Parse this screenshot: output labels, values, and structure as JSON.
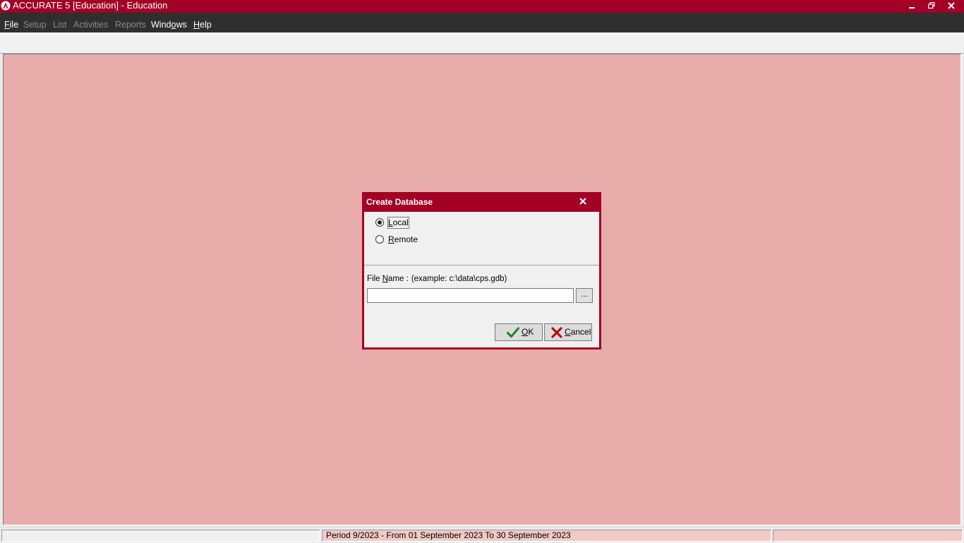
{
  "window": {
    "title": "ACCURATE 5 [Education] - Education",
    "accent_color": "#a20025",
    "workspace_color": "#e8adab"
  },
  "menu": {
    "items": [
      {
        "pre": "",
        "hot": "F",
        "post": "ile",
        "enabled": true
      },
      {
        "pre": "Setup",
        "hot": "",
        "post": "",
        "enabled": false
      },
      {
        "pre": "List",
        "hot": "",
        "post": "",
        "enabled": false
      },
      {
        "pre": "Activities",
        "hot": "",
        "post": "",
        "enabled": false
      },
      {
        "pre": "Reports",
        "hot": "",
        "post": "",
        "enabled": false
      },
      {
        "pre": "Wind",
        "hot": "o",
        "post": "ws",
        "enabled": true
      },
      {
        "pre": "",
        "hot": "H",
        "post": "elp",
        "enabled": true
      }
    ]
  },
  "dialog": {
    "title": "Create Database",
    "options": [
      {
        "hot": "L",
        "rest": "ocal",
        "selected": true
      },
      {
        "hot": "R",
        "rest": "emote",
        "selected": false
      }
    ],
    "file_name_pre": "File ",
    "file_name_hot": "N",
    "file_name_post": "ame :",
    "file_name_example": "(example: c:\\data\\cps.gdb)",
    "file_name_value": "",
    "browse_label": "...",
    "ok_hot": "O",
    "ok_rest": "K",
    "cancel_hot": "C",
    "cancel_rest": "ancel"
  },
  "statusbar": {
    "left": "",
    "period": "Period 9/2023 - From 01 September 2023 To 30 September 2023",
    "right": ""
  }
}
